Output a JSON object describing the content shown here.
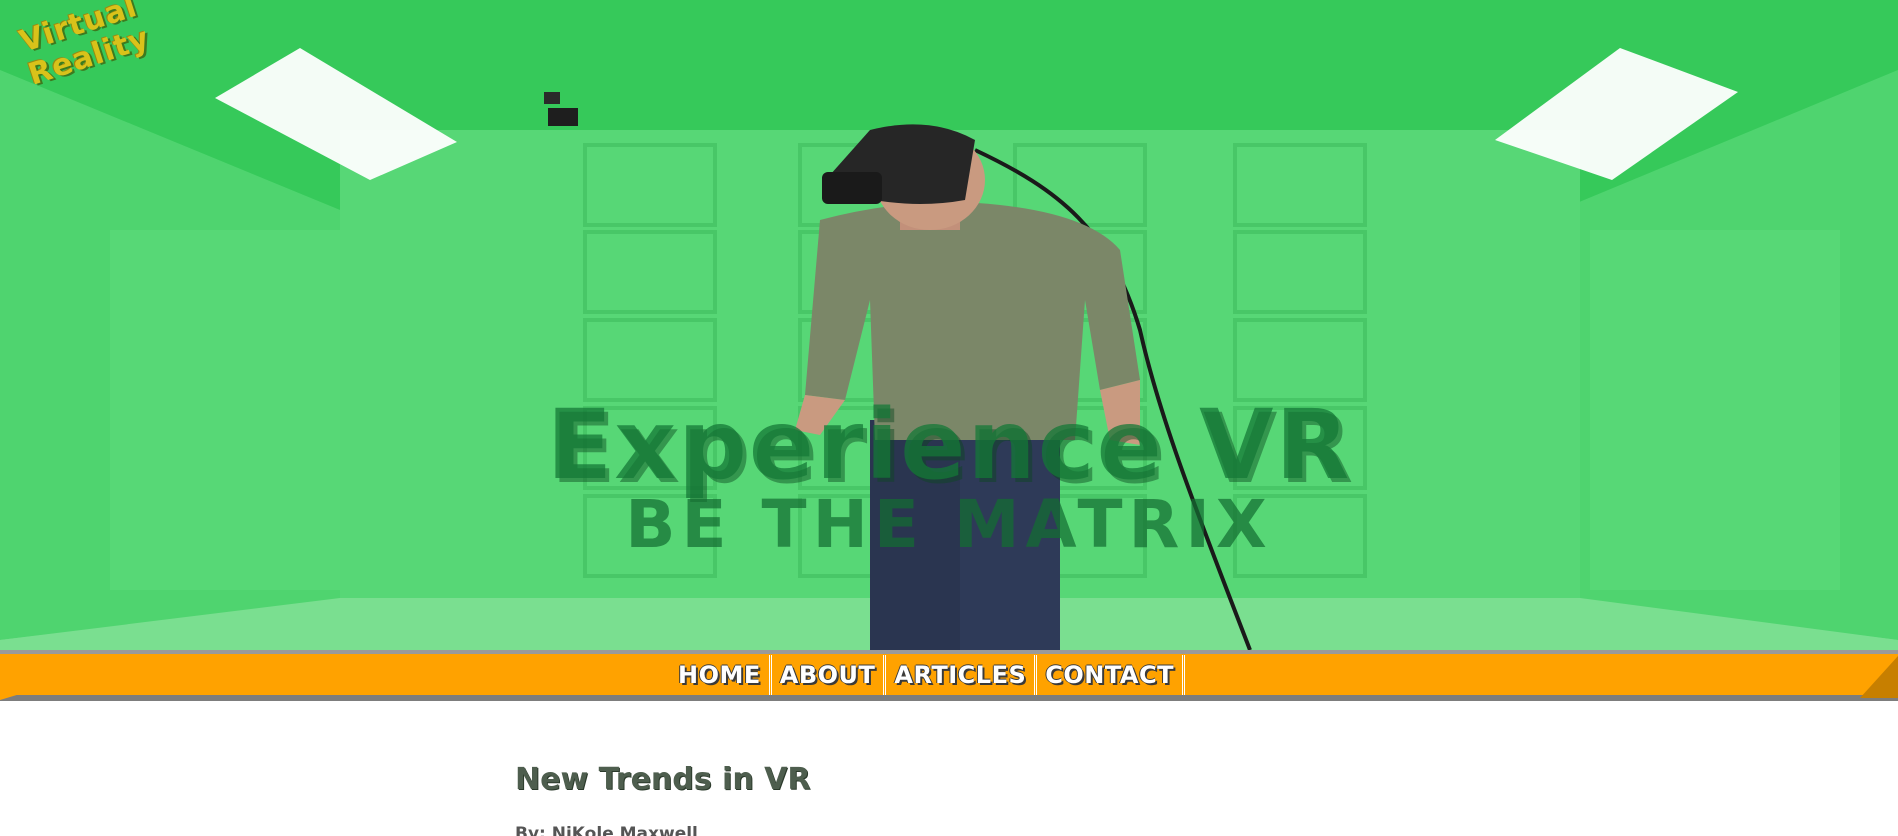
{
  "site": {
    "logo_line1": "Virtual",
    "logo_line2": "Reality"
  },
  "hero": {
    "title": "Experience VR",
    "subtitle": "BE THE MATRIX",
    "background_color": "#41d465"
  },
  "nav": {
    "bar_color": "#ffa200",
    "items": [
      {
        "label": "HOME"
      },
      {
        "label": "ABOUT"
      },
      {
        "label": "ARTICLES"
      },
      {
        "label": "CONTACT"
      }
    ]
  },
  "article": {
    "title": "New Trends in VR",
    "byline": "By: NiKole Maxwell"
  }
}
